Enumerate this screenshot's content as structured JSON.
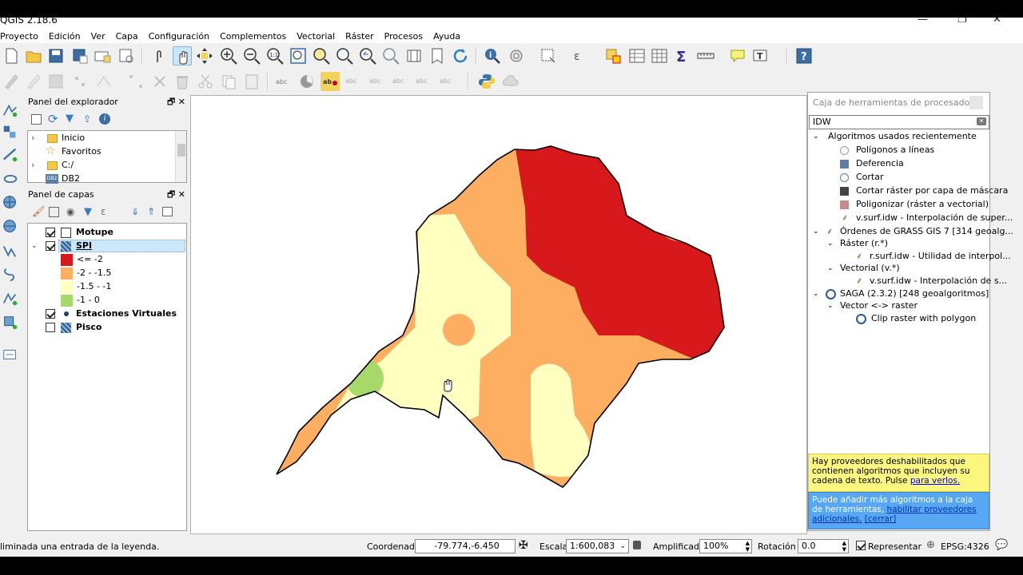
{
  "window": {
    "title": "QGIS 2.18.6"
  },
  "menu": [
    "Proyecto",
    "Edición",
    "Ver",
    "Capa",
    "Configuración",
    "Complementos",
    "Vectorial",
    "Ráster",
    "Procesos",
    "Ayuda"
  ],
  "browser_panel": {
    "title": "Panel del explorador",
    "items": [
      "Inicio",
      "Favoritos",
      "C:/",
      "DB2"
    ]
  },
  "layers_panel": {
    "title": "Panel de capas",
    "layers": [
      {
        "name": "Motupe",
        "checked": true
      },
      {
        "name": "SPI",
        "checked": true,
        "selected": true
      },
      {
        "name": "Estaciones Virtuales",
        "checked": true
      },
      {
        "name": "Pisco",
        "checked": false
      }
    ],
    "legend": [
      {
        "label": "<= -2",
        "color": "#d7191c"
      },
      {
        "label": "-2 - -1.5",
        "color": "#fdae61"
      },
      {
        "label": "-1.5 - -1",
        "color": "#ffffc0"
      },
      {
        "label": "-1 - 0",
        "color": "#a6d96a"
      }
    ]
  },
  "processing": {
    "title": "Caja de herramientas de procesado",
    "search_value": "IDW",
    "tree": {
      "recent_label": "Algoritmos usados recientemente",
      "recent": [
        "Polígonos a líneas",
        "Deferencia",
        "Cortar",
        "Cortar ráster por capa de máscara",
        "Poligonizar (ráster a vectorial)",
        "v.surf.idw - Interpolación de super..."
      ],
      "grass_label": "Órdenes de GRASS GIS 7 [314 geoalg...",
      "raster_label": "Ráster (r.*)",
      "raster_item": "r.surf.idw - Utilidad de interpol...",
      "vector_label": "Vectorial (v.*)",
      "vector_item": "v.surf.idw - Interpolación de s...",
      "saga_label": "SAGA (2.3.2) [248 geoalgoritmos]",
      "saga_group": "Vector <-> raster",
      "saga_item": "Clip raster with polygon"
    },
    "notice1": {
      "text": "Hay proveedores deshabilitados que contienen algoritmos que incluyen su cadena de texto. Pulse",
      "link": "para verlos."
    },
    "notice2": {
      "text": "Puede añadir más algoritmos a la caja de herramientas,",
      "link1": "habilitar proveedores adicionales.",
      "link2": "[cerrar]"
    }
  },
  "status": {
    "message": "liminada una entrada de la leyenda.",
    "coord_label": "Coordenada",
    "coord_value": "-79.774,-6.450",
    "scale_label": "Escala",
    "scale_value": "1:600,083",
    "magnifier_label": "Amplificador",
    "magnifier_value": "100%",
    "rotation_label": "Rotación",
    "rotation_value": "0.0",
    "render_label": "Representar",
    "crs": "EPSG:4326"
  },
  "colors": {
    "red": "#d7191c",
    "orange": "#fdae61",
    "yellow": "#ffffc0",
    "green": "#a6d96a",
    "selection": "#cce8ff"
  }
}
